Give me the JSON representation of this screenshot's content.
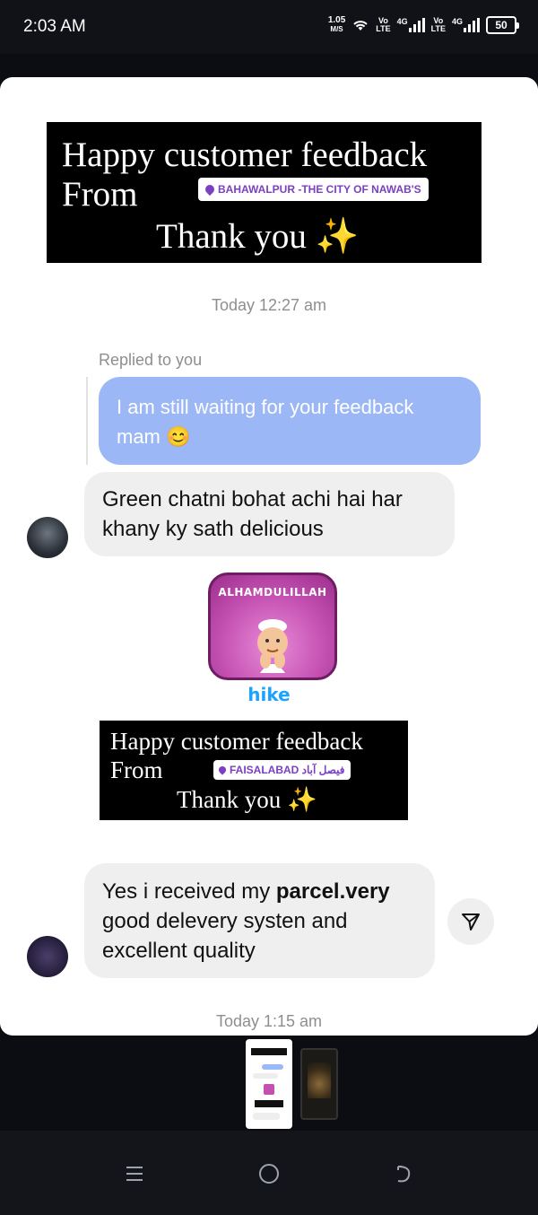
{
  "status_bar": {
    "time": "2:03 AM",
    "speed_value": "1.05",
    "speed_unit": "M/S",
    "sim1_label_top": "Vo",
    "sim1_label_bottom": "LTE",
    "sim1_net": "4G",
    "sim2_label_top": "Vo",
    "sim2_label_bottom": "LTE",
    "sim2_net": "4G",
    "battery": "50"
  },
  "chat": {
    "banner1": {
      "line1": "Happy customer feedback",
      "line2": "From",
      "location": "BAHAWALPUR -THE CITY OF NAWAB'S",
      "line3": "Thank you",
      "emoji": "✨"
    },
    "timestamp1": "Today 12:27 am",
    "replied_label": "Replied to you",
    "reply_message": "I am still waiting for your feedback mam 😊",
    "message1": "Green chatni bohat achi hai har khany ky sath delicious",
    "sticker_text": "ALHAMDULILLAH",
    "sticker_brand": "hike",
    "banner2": {
      "line1": "Happy customer feedback",
      "line2": "From",
      "location": "FAISALABAD فیصل آباد",
      "line3": "Thank you",
      "emoji": "✨"
    },
    "message2_part1": "Yes i received my ",
    "message2_bold": "parcel.very",
    "message2_part2": " good delevery systen and excellent quality",
    "timestamp2": "Today 1:15 am"
  },
  "colors": {
    "reply_bubble": "#9cb7f5",
    "received_bubble": "#efefef",
    "location_tag_text": "#7b3fc2",
    "hike_brand": "#1aa3ff"
  },
  "icons": {
    "share": "send-icon",
    "nav_recent": "recent-apps-icon",
    "nav_home": "home-icon",
    "nav_back": "back-icon"
  }
}
